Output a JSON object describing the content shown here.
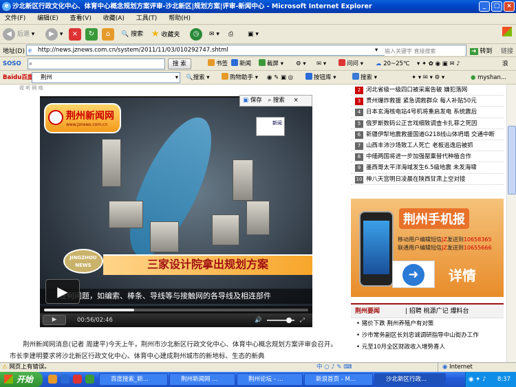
{
  "window": {
    "title": "沙北新区行政文化中心、体育中心概念规划方案评审-沙北新区|规划方案|评审-新闻中心 - Microsoft Internet Explorer"
  },
  "menu": [
    "文件(F)",
    "编辑(E)",
    "查看(V)",
    "收藏(A)",
    "工具(T)",
    "帮助(H)"
  ],
  "toolbar": {
    "back": "后退",
    "search": "搜索",
    "favorites": "收藏夹"
  },
  "address": {
    "label": "地址(D)",
    "url": "http://news.jznews.com.cn/system/2011/11/03/010292747.shtml",
    "search_placeholder": "输入关键字 直接搜索",
    "go": "转到",
    "links": "链接"
  },
  "soso": {
    "logo": "SOSO",
    "search_btn": "搜 索",
    "items": [
      "书签",
      "新闻",
      "截屏",
      "问问"
    ],
    "weather": "20~25℃",
    "more": "浪"
  },
  "baidu": {
    "logo": "Baidu百度",
    "query": "荆州",
    "search": "搜索",
    "shop": "购物助手",
    "button_lib": "按钮库",
    "search2": "搜索",
    "user": "myshan..."
  },
  "player": {
    "brand": "荆州新闻网",
    "brand_url": "www.jznews.com.cn",
    "channel": "新闻",
    "badge": "JINGZHOU NEWS",
    "headline": "三家设计院拿出规划方案",
    "ticker": "任何问题，如编索、棒条、导线等与接触网的各导线及相连部件",
    "save": "保存",
    "search": "搜索",
    "time": "00:56/02:46",
    "progress": 0.34
  },
  "article": {
    "text": "荆州新闻网消息(记者 周建平)今天上午，荆州市沙北新区行政文化中心、体育中心概念规划方案评审会召开。市长李建明要求将沙北新区行政文化中心、体育中心建成荆州城市的新地标、生态的新典"
  },
  "news_list": [
    {
      "n": "2",
      "hot": true,
      "title": "河北省级一级四口被采案告破 嫌犯落网"
    },
    {
      "n": "3",
      "hot": true,
      "title": "贵州爆炸救援 紧急调救群众 每人补贴50元"
    },
    {
      "n": "4",
      "hot": false,
      "title": "日本玄海核电站4号机将重启发电 系统震后"
    },
    {
      "n": "5",
      "hot": false,
      "title": "俄罗斯数码公正言戏细致调查卡扎菲之死因"
    },
    {
      "n": "6",
      "hot": false,
      "title": "新疆伊犁地震救援国道G218线山体坍塌 交通中断"
    },
    {
      "n": "7",
      "hot": false,
      "title": "山西丰沛沙场致工人死亡 老板逃逸后被抓"
    },
    {
      "n": "8",
      "hot": false,
      "title": "中缅两国将进一步加强罂粟替代种植合作"
    },
    {
      "n": "9",
      "hot": false,
      "title": "墨西哥太平洋海域发生6.5级地震 未发海啸"
    },
    {
      "n": "10",
      "hot": false,
      "title": "神八天宫明日凌晨在陕西甘肃上空对接"
    }
  ],
  "ad": {
    "title": "荆州手机报",
    "line1_a": "移动用户编辑短信",
    "line1_b": "JZ",
    "line1_c": "发送到",
    "line1_num": "10658365",
    "line2_a": "联通用户编辑短信",
    "line2_b": "JZ",
    "line2_c": "发送到",
    "line2_num": "10655666",
    "detail": "详情"
  },
  "jz_news": {
    "title": "荆州要闻",
    "links": "| 招聘 桃源广记 爆料台",
    "items": [
      "猪价下跌 荆州养殖户有对策",
      "沙市常务副区长刘忠诚调研指导中山街办工作",
      "元至10月全区财政收入增势喜人"
    ]
  },
  "status": {
    "text": "网页上有错误。",
    "zone": "Internet"
  },
  "taskbar": {
    "start": "开始",
    "tasks": [
      "百度搜索_新...",
      "荆州新闻网 ...",
      "荆州论坛 - ...",
      "新浪首页 - M...",
      "沙北新区行政..."
    ],
    "clock": "8:37"
  }
}
